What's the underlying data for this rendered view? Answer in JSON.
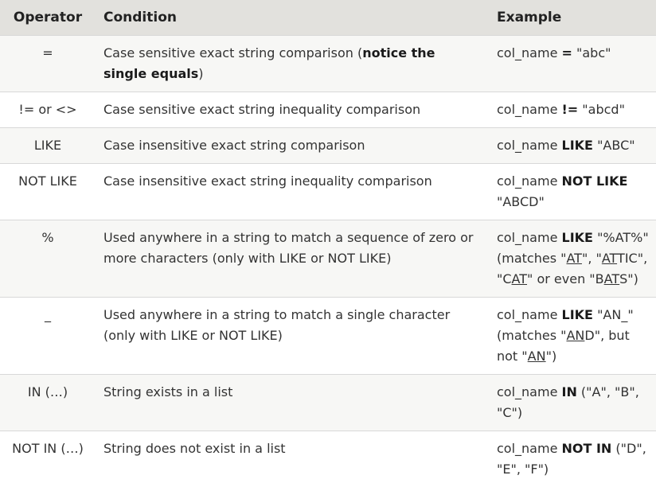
{
  "headers": {
    "operator": "Operator",
    "condition": "Condition",
    "example": "Example"
  },
  "rows": [
    {
      "operator": "=",
      "condition": [
        {
          "t": "Case sensitive exact string comparison ("
        },
        {
          "t": "notice the single equals",
          "b": true
        },
        {
          "t": ")"
        }
      ],
      "example": [
        {
          "t": "col_name "
        },
        {
          "t": "=",
          "b": true
        },
        {
          "t": " \"abc\""
        }
      ]
    },
    {
      "operator": "!= or <>",
      "condition": [
        {
          "t": "Case sensitive exact string inequality comparison"
        }
      ],
      "example": [
        {
          "t": "col_name "
        },
        {
          "t": "!=",
          "b": true
        },
        {
          "t": " \"abcd\""
        }
      ]
    },
    {
      "operator": "LIKE",
      "condition": [
        {
          "t": "Case insensitive exact string comparison"
        }
      ],
      "example": [
        {
          "t": "col_name "
        },
        {
          "t": "LIKE",
          "b": true
        },
        {
          "t": " \"ABC\""
        }
      ]
    },
    {
      "operator": "NOT LIKE",
      "condition": [
        {
          "t": "Case insensitive exact string inequality comparison"
        }
      ],
      "example": [
        {
          "t": "col_name "
        },
        {
          "t": "NOT LIKE",
          "b": true
        },
        {
          "t": " \"ABCD\""
        }
      ]
    },
    {
      "operator": "%",
      "condition": [
        {
          "t": "Used anywhere in a string to match a sequence of zero or more characters (only with LIKE or NOT LIKE)"
        }
      ],
      "example": [
        {
          "t": "col_name "
        },
        {
          "t": "LIKE",
          "b": true
        },
        {
          "t": " \"%AT%\" (matches \""
        },
        {
          "t": "AT",
          "u": true
        },
        {
          "t": "\", \""
        },
        {
          "t": "AT",
          "u": true
        },
        {
          "t": "TIC\", \"C"
        },
        {
          "t": "AT",
          "u": true
        },
        {
          "t": "\" or even \"B"
        },
        {
          "t": "AT",
          "u": true
        },
        {
          "t": "S\")"
        }
      ]
    },
    {
      "operator": "_",
      "condition": [
        {
          "t": "Used anywhere in a string to match a single character (only with LIKE or NOT LIKE)"
        }
      ],
      "example": [
        {
          "t": "col_name "
        },
        {
          "t": "LIKE",
          "b": true
        },
        {
          "t": " \"AN_\" (matches \""
        },
        {
          "t": "AN",
          "u": true
        },
        {
          "t": "D\", but not \""
        },
        {
          "t": "AN",
          "u": true
        },
        {
          "t": "\")"
        }
      ]
    },
    {
      "operator": "IN (…)",
      "condition": [
        {
          "t": "String exists in a list"
        }
      ],
      "example": [
        {
          "t": "col_name "
        },
        {
          "t": "IN",
          "b": true
        },
        {
          "t": " (\"A\", \"B\", \"C\")"
        }
      ]
    },
    {
      "operator": "NOT IN (…)",
      "condition": [
        {
          "t": "String does not exist in a list"
        }
      ],
      "example": [
        {
          "t": "col_name "
        },
        {
          "t": "NOT IN",
          "b": true
        },
        {
          "t": " (\"D\", \"E\", \"F\")"
        }
      ]
    }
  ]
}
